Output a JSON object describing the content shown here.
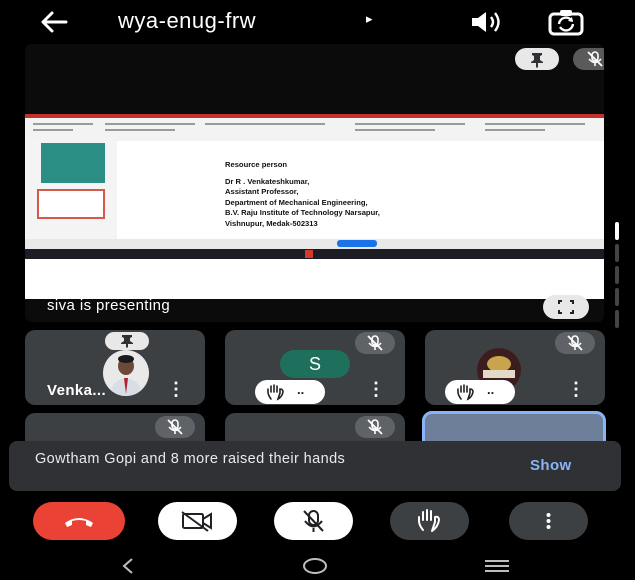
{
  "header": {
    "title": "wya-enug-frw",
    "caret": "▸",
    "icons": [
      "back-arrow-icon",
      "volume-icon",
      "camera-flip-icon"
    ]
  },
  "presentation": {
    "label": "siva is presenting",
    "slide": {
      "heading": "Resource person",
      "lines": [
        "Dr  R . Venkateshkumar,",
        "Assistant Professor,",
        "Department of Mechanical Engineering,",
        " B.V. Raju Institute of Technology Narsapur,",
        "Vishnupur, Medak-502313"
      ]
    }
  },
  "tiles": [
    {
      "name": "Venka...",
      "kind": "photo"
    },
    {
      "initial": "S",
      "kind": "initial",
      "hand": "..",
      "accent": "#1e6f5c"
    },
    {
      "kind": "photo",
      "hand": ".."
    }
  ],
  "toast": {
    "message": "Gowtham Gopi and 8 more raised their hands",
    "action": "Show"
  },
  "colors": {
    "end_call": "#ea4335",
    "tile_bg": "#3c4043",
    "link": "#8ab4f8"
  }
}
